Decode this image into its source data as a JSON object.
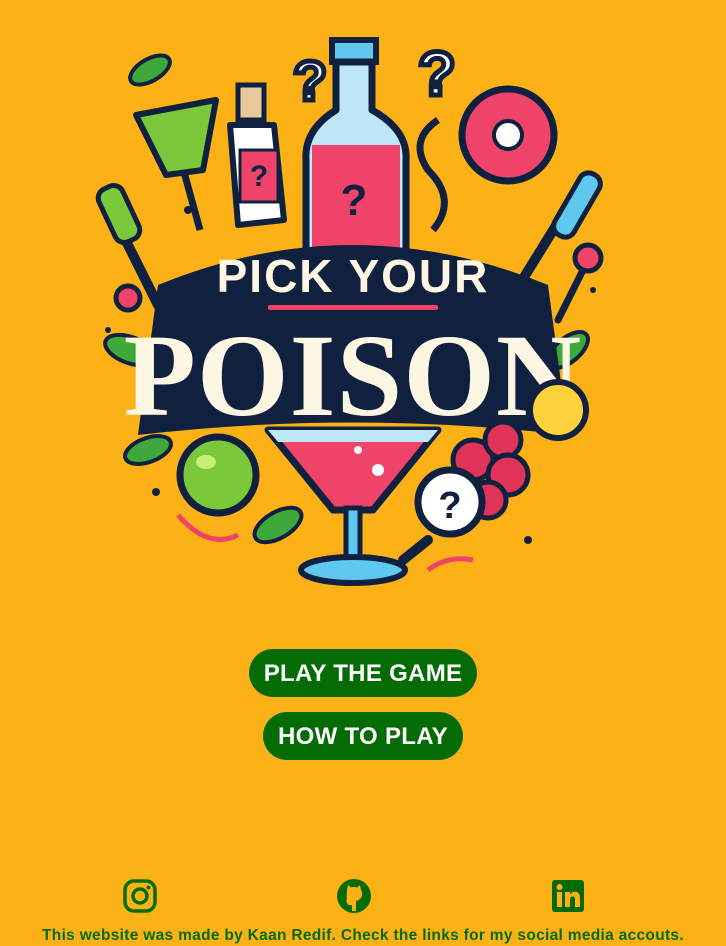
{
  "logo": {
    "line1": "PICK YOUR",
    "line2": "POISON",
    "question_mark": "?"
  },
  "buttons": {
    "play_label": "PLAY THE GAME",
    "how_label": "HOW TO PLAY",
    "color": "#056b05"
  },
  "social": [
    {
      "icon": "instagram-icon"
    },
    {
      "icon": "github-icon"
    },
    {
      "icon": "linkedin-icon"
    }
  ],
  "footer": {
    "text": "This website was made by Kaan Redif. Check the links for my social media accouts."
  },
  "colors": {
    "background": "#fcb116",
    "accent": "#056b05",
    "navy": "#10203f",
    "pink": "#f0436a"
  }
}
